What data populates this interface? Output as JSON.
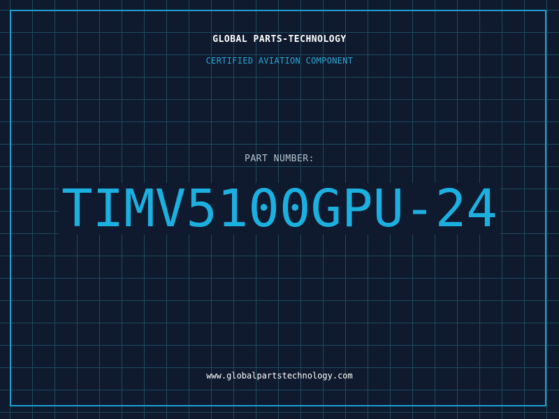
{
  "header": {
    "company": "GLOBAL PARTS-TECHNOLOGY",
    "subtitle": "CERTIFIED AVIATION COMPONENT"
  },
  "part": {
    "label": "PART NUMBER:",
    "number": "TIMV5100GPU-24"
  },
  "footer": {
    "url": "www.globalpartstechnology.com"
  },
  "colors": {
    "background": "#0f1a2e",
    "grid": "#1e4a5e",
    "border": "#1a9fd0",
    "accent": "#1cb0e0"
  }
}
